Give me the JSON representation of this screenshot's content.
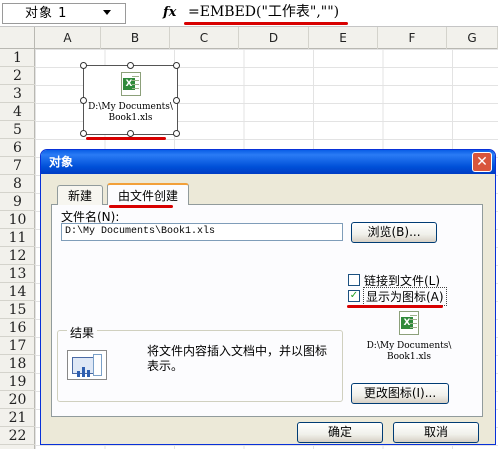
{
  "formula_bar": {
    "name_box": "对象 1",
    "fx": "fx",
    "formula": "=EMBED(\"工作表\",\"\")"
  },
  "columns": [
    "A",
    "B",
    "C",
    "D",
    "E",
    "F",
    "G"
  ],
  "rows": [
    "1",
    "2",
    "3",
    "4",
    "5",
    "6",
    "7",
    "8",
    "9",
    "10",
    "11",
    "12",
    "13",
    "14",
    "15",
    "16",
    "17",
    "18",
    "19",
    "20",
    "21",
    "22"
  ],
  "embedded_object": {
    "caption_line1": "D:\\My Documents\\",
    "caption_line2": "Book1.xls"
  },
  "dialog": {
    "title": "对象",
    "close_glyph": "✕",
    "tabs": [
      "新建",
      "由文件创建"
    ],
    "filename_label": "文件名(N):",
    "filename_value": "D:\\My Documents\\Book1.xls",
    "browse_label": "浏览(B)...",
    "link_label": "链接到文件(L)",
    "link_checked": false,
    "display_icon_label": "显示为图标(A)",
    "display_icon_checked": true,
    "check_glyph": "✓",
    "result_title": "结果",
    "result_text": "将文件内容插入文档中，并以图标表示。",
    "preview_caption_line1": "D:\\My Documents\\",
    "preview_caption_line2": "Book1.xls",
    "change_icon_label": "更改图标(I)...",
    "ok_label": "确定",
    "cancel_label": "取消"
  },
  "colors": {
    "annotation_red": "#d80000",
    "titlebar_blue": "#0050d8"
  },
  "icons": [
    "dropdown-arrow-icon",
    "fx-icon",
    "excel-file-icon",
    "close-icon",
    "checkmark-icon",
    "result-icon"
  ]
}
